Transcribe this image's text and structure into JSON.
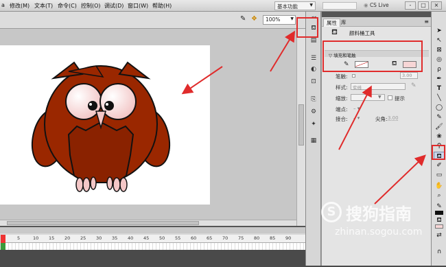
{
  "menubar": {
    "items": [
      "a",
      "修改(M)",
      "文本(T)",
      "命令(C)",
      "控制(O)",
      "调试(D)",
      "窗口(W)",
      "帮助(H)"
    ],
    "workspace": "基本功能",
    "cs_live": "CS Live",
    "window_controls": [
      "-",
      "□",
      "×"
    ]
  },
  "editbar": {
    "zoom": "100%",
    "icons": [
      "edit-symbol-icon",
      "edit-scene-icon"
    ]
  },
  "timeline": {
    "ticks": [
      "5",
      "10",
      "15",
      "20",
      "25",
      "30",
      "35",
      "40",
      "45",
      "50",
      "55",
      "60",
      "65",
      "70",
      "75",
      "80",
      "85",
      "90"
    ]
  },
  "properties": {
    "tabs": [
      "属性",
      "库"
    ],
    "tool_name": "颜料桶工具",
    "section_fill_stroke": "填充和笔触",
    "rows": {
      "stroke_label": "笔触:",
      "stroke_value": "3.00",
      "style_label": "样式:",
      "style_value": "实线",
      "scale_label": "缩放:",
      "hint_label": "提示",
      "cap_label": "端点:",
      "join_label": "接合:",
      "miter_label": "尖角:",
      "miter_value": "3.00"
    }
  },
  "colors": {
    "owl_body": "#9a2700",
    "fill_swatch": "#f7d6d6",
    "highlight_red": "#e02b2b",
    "stage_bg": "#ffffff",
    "workspace_bg": "#c7c7c7"
  },
  "toolbox": {
    "tools": [
      "selection-icon",
      "subselection-icon",
      "free-transform-icon",
      "3d-rotation-icon",
      "lasso-icon",
      "pen-icon",
      "text-icon",
      "line-icon",
      "rectangle-icon",
      "pencil-icon",
      "brush-icon",
      "deco-icon",
      "bone-icon",
      "paint-bucket-icon",
      "eyedropper-icon",
      "eraser-icon",
      "hand-icon",
      "zoom-icon",
      "stroke-color-icon",
      "fill-color-icon",
      "swap-colors-icon",
      "snap-icon"
    ]
  },
  "watermark": {
    "logo": "搜狗指南",
    "url": "zhinan.sogou.com"
  }
}
